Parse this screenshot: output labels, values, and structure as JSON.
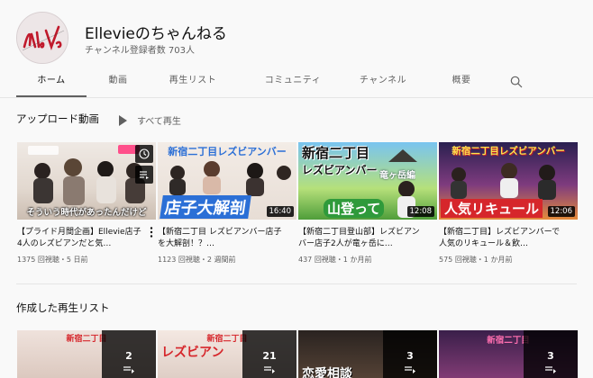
{
  "channel": {
    "name": "Ellevieのちゃんねる",
    "subscribers": "チャンネル登録者数 703人",
    "avatar_text": "Elle Vie"
  },
  "tabs": [
    {
      "label": "ホーム",
      "active": true
    },
    {
      "label": "動画",
      "active": false
    },
    {
      "label": "再生リスト",
      "active": false
    },
    {
      "label": "コミュニティ",
      "active": false
    },
    {
      "label": "チャンネル",
      "active": false
    },
    {
      "label": "概要",
      "active": false
    }
  ],
  "uploads": {
    "title": "アップロード動画",
    "play_all": "すべて再生",
    "videos": [
      {
        "title": "【プライド月間企画】Ellevie店子4人のレズビアンだと気…",
        "views": "1375 回視聴・5 日前",
        "duration": "",
        "thumb_text": "そういう時代があったんだけど"
      },
      {
        "title": "【新宿二丁目 レズビアンバー店子を大解剖！？…",
        "views": "1123 回視聴・2 週間前",
        "duration": "16:40",
        "thumb_text": "新宿二丁目レズビアンバー",
        "thumb_text2": "店子大解剖"
      },
      {
        "title": "【新宿二丁目登山部】レズビアンバー店子2人が竜ヶ岳に…",
        "views": "437 回視聴・1 か月前",
        "duration": "12:08",
        "thumb_text": "新宿二丁目",
        "thumb_text2": "レズビアンバー",
        "thumb_text3": "竜ヶ岳編",
        "thumb_text4": "山登って"
      },
      {
        "title": "【新宿二丁目】レズビアンバーで人気のリキュール＆飲…",
        "views": "575 回視聴・1 か月前",
        "duration": "12:06",
        "thumb_text": "新宿二丁目レズビアンバー",
        "thumb_text2": "人気リキュール"
      }
    ]
  },
  "playlists": {
    "title": "作成した再生リスト",
    "items": [
      {
        "count": "2",
        "thumb_text": "新宿二丁目"
      },
      {
        "count": "21",
        "thumb_text": "新宿二丁目",
        "thumb_text2": "レズビアン"
      },
      {
        "count": "3",
        "thumb_text": "恋愛相談"
      },
      {
        "count": "3",
        "thumb_text": "新宿二丁目"
      }
    ]
  },
  "colors": {
    "accent": "#0f0f0f",
    "secondary_text": "#606060",
    "background": "#f9f9f9",
    "thumb_banner_red": "#d6262b",
    "thumb_banner_blue": "#2b6fd6"
  }
}
